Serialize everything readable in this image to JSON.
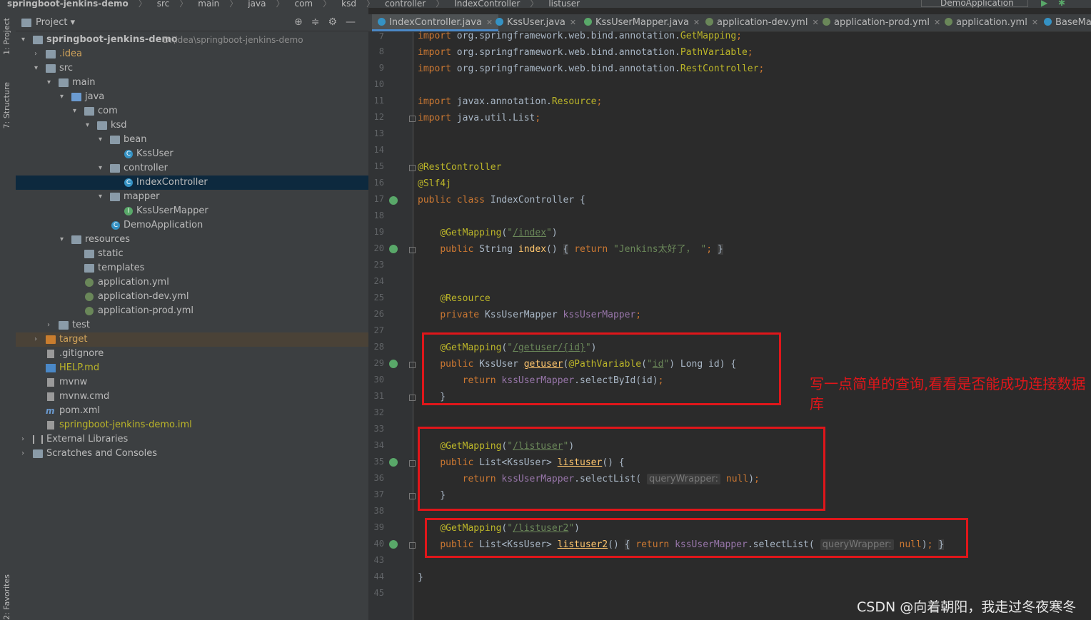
{
  "breadcrumb": [
    "springboot-jenkins-demo",
    "src",
    "main",
    "java",
    "com",
    "ksd",
    "controller",
    "IndexController",
    "listuser"
  ],
  "run_config": "DemoApplication",
  "left_strip": {
    "project": "1: Project",
    "structure": "7: Structure",
    "favorites": "2: Favorites"
  },
  "project_panel": {
    "title": "Project",
    "root_name": "springboot-jenkins-demo",
    "root_path": "D:\\idea\\springboot-jenkins-demo",
    "items": [
      ".idea",
      "src",
      "main",
      "java",
      "com",
      "ksd",
      "bean",
      "KssUser",
      "controller",
      "IndexController",
      "mapper",
      "KssUserMapper",
      "DemoApplication",
      "resources",
      "static",
      "templates",
      "application.yml",
      "application-dev.yml",
      "application-prod.yml",
      "test",
      "target",
      ".gitignore",
      "HELP.md",
      "mvnw",
      "mvnw.cmd",
      "pom.xml",
      "springboot-jenkins-demo.iml",
      "External Libraries",
      "Scratches and Consoles"
    ]
  },
  "tabs": [
    "IndexController.java",
    "KssUser.java",
    "KssUserMapper.java",
    "application-dev.yml",
    "application-prod.yml",
    "application.yml",
    "BaseMap"
  ],
  "line_numbers": [
    "7",
    "8",
    "9",
    "10",
    "11",
    "12",
    "13",
    "14",
    "15",
    "16",
    "17",
    "18",
    "19",
    "20",
    "23",
    "24",
    "25",
    "26",
    "27",
    "28",
    "29",
    "30",
    "31",
    "32",
    "33",
    "34",
    "35",
    "36",
    "37",
    "38",
    "39",
    "40",
    "43",
    "44",
    "45"
  ],
  "code": {
    "imp1": "org.springframework.web.bind.annotation.",
    "imp1_cls": "GetMapping",
    "imp2": "org.springframework.web.bind.annotation.",
    "imp2_cls": "PathVariable",
    "imp3": "org.springframework.web.bind.annotation.",
    "imp3_cls": "RestController",
    "imp4": "javax.annotation.",
    "imp4_cls": "Resource",
    "imp5": "java.util.List",
    "ann_rest": "@RestController",
    "ann_slf": "@Slf4j",
    "class_name": "IndexController",
    "map_index": "/index",
    "index_ret": "\"Jenkins太好了， \"",
    "ann_resource": "@Resource",
    "mapper_type": "KssUserMapper",
    "mapper_field": "kssUserMapper",
    "map_getuser": "/getuser/{id}",
    "pv_name": "id",
    "select_by_id": "selectById",
    "map_listuser": "/listuser",
    "select_list": "selectList",
    "hint_qw": "queryWrapper:",
    "map_listuser2": "/listuser2"
  },
  "annotation_note": "写一点简单的查询,看看是否能成功连接数据库",
  "watermark": "CSDN @向着朝阳，我走过冬夜寒冬"
}
